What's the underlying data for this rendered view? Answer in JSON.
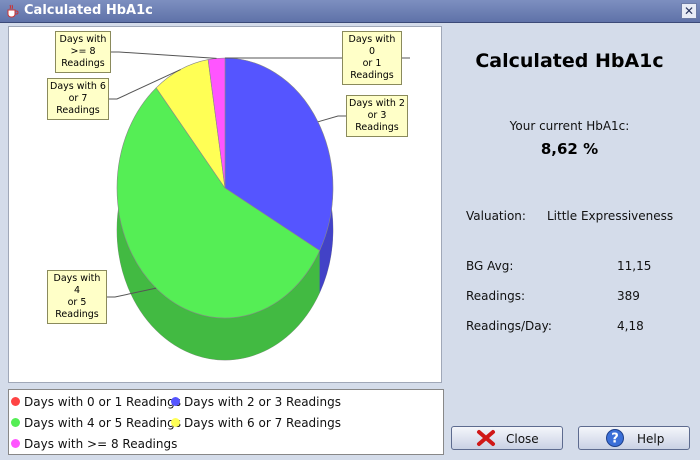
{
  "window": {
    "title": "Calculated HbA1c"
  },
  "chart_data": {
    "type": "pie",
    "title": "",
    "slices": [
      {
        "label": "Days with 0 or 1 Readings",
        "callout": [
          "Days with 0",
          "or 1",
          "Readings"
        ],
        "value": 0,
        "color": "#ff4444"
      },
      {
        "label": "Days with 2 or 3 Readings",
        "callout": [
          "Days with 2",
          "or 3",
          "Readings"
        ],
        "value": 33,
        "color": "#5555ff"
      },
      {
        "label": "Days with 4 or 5 Readings",
        "callout": [
          "Days with 4",
          "or 5",
          "Readings"
        ],
        "value": 56,
        "color": "#55ee55"
      },
      {
        "label": "Days with 6 or 7 Readings",
        "callout": [
          "Days with 6",
          "or 7",
          "Readings"
        ],
        "value": 8.5,
        "color": "#ffff55"
      },
      {
        "label": "Days with >= 8 Readings",
        "callout": [
          "Days with",
          ">= 8",
          "Readings"
        ],
        "value": 2.5,
        "color": "#ff55ff"
      }
    ],
    "legend_placement": "bottom"
  },
  "info": {
    "title": "Calculated HbA1c",
    "current_label": "Your current HbA1c:",
    "current_value": "8,62 %",
    "valuation_label": "Valuation:",
    "valuation_value": "Little Expressiveness",
    "bg_avg_label": "BG Avg:",
    "bg_avg_value": "11,15",
    "readings_label": "Readings:",
    "readings_value": "389",
    "readings_day_label": "Readings/Day:",
    "readings_day_value": "4,18"
  },
  "buttons": {
    "close": "Close",
    "help": "Help"
  },
  "icons": {
    "app": "java-cup-icon",
    "close": "close-x-icon",
    "help": "help-question-icon"
  }
}
